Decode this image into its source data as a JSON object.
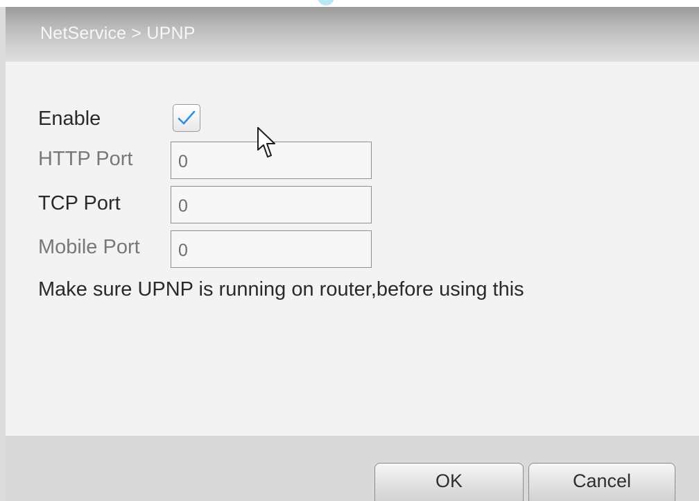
{
  "window": {
    "title": "NetService > UPNP"
  },
  "form": {
    "enable": {
      "label": "Enable",
      "checked": true
    },
    "http_port": {
      "label": "HTTP Port",
      "value": "0"
    },
    "tcp_port": {
      "label": "TCP Port",
      "value": "0"
    },
    "mobile_port": {
      "label": "Mobile Port",
      "value": "0"
    },
    "notice": "Make sure UPNP is running on router,before using this"
  },
  "buttons": {
    "ok": "OK",
    "cancel": "Cancel"
  },
  "colors": {
    "checkmark": "#2f8fe0",
    "title_text": "#f7f7f7"
  },
  "icons": {
    "checkbox": "checkmark-icon",
    "cursor": "mouse-pointer-icon"
  }
}
